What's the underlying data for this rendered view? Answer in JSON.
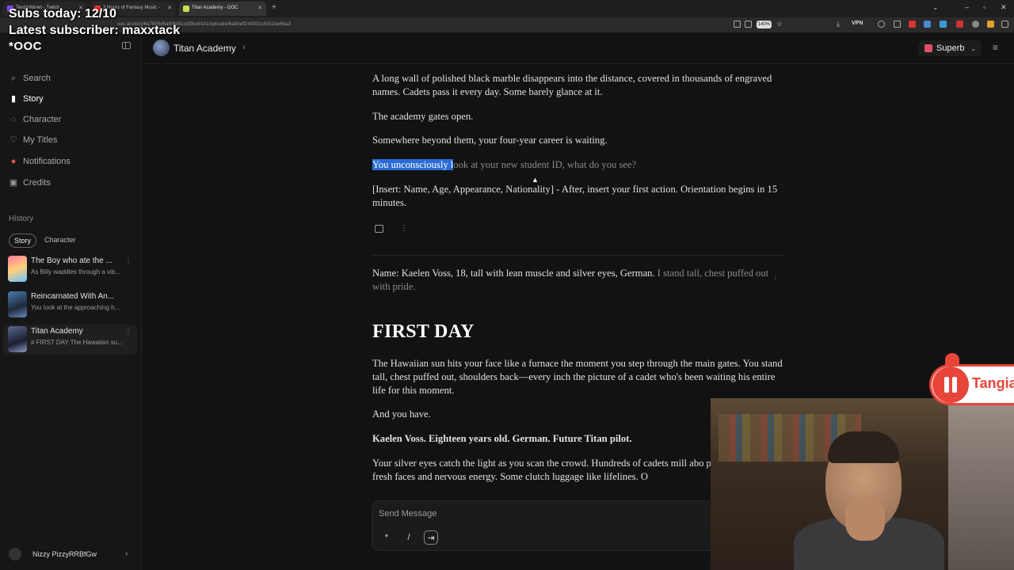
{
  "browser": {
    "tabs": [
      {
        "label": "TenzinNimet - Twitch",
        "color": "#9146ff"
      },
      {
        "label": "3 Hours of Fantasy Music -",
        "color": "#ff3030"
      },
      {
        "label": "Titan Academy - OOC",
        "color": "#c8e050"
      }
    ],
    "url": "ooc.ai/story/6a7b05d5af09e51cd3fce9141/episode/6a90eff240031c5011be65a3",
    "zoom": "140%",
    "vpn": "VPN"
  },
  "overlay": {
    "subs": "Subs today: 12/10",
    "latest": "Latest subscriber: maxxtack"
  },
  "sidebar": {
    "logo": "*OOC",
    "nav": [
      {
        "label": "Search",
        "icon": "search-icon"
      },
      {
        "label": "Story",
        "icon": "book-icon"
      },
      {
        "label": "Character",
        "icon": "chat-icon"
      },
      {
        "label": "My Titles",
        "icon": "heart-icon"
      },
      {
        "label": "Notifications",
        "icon": "bell-icon"
      },
      {
        "label": "Credits",
        "icon": "credits-icon"
      }
    ],
    "history_heading": "History",
    "filters": [
      "Story",
      "Character"
    ],
    "history": [
      {
        "title": "The Boy who ate the ...",
        "snippet": "As Billy waddles through a vib..."
      },
      {
        "title": "Reincarnated With An...",
        "snippet": "You look at the approaching h..."
      },
      {
        "title": "Titan Academy",
        "snippet": "# FIRST DAY The Hawaiian su..."
      }
    ],
    "user": "Nizzy PizzyRRBfGw"
  },
  "header": {
    "title": "Titan Academy",
    "model": "Superb"
  },
  "story": {
    "p1": "A long wall of polished black marble disappears into the distance, covered in thousands of engraved names. Cadets pass it every day. Some barely glance at it.",
    "p2": "The academy gates open.",
    "p3": "Somewhere beyond them, your four-year career is waiting.",
    "p4_highlight": "You unconsciously l",
    "p4_rest": "ook at your new student ID, what do you see?",
    "p5": "[Insert: Name, Age, Appearance, Nationality] - After, insert your first action. Orientation begins in 15 minutes.",
    "user_msg_main": "Name: Kaelen Voss, 18, tall with lean muscle and silver eyes, German.",
    "user_msg_action": "I stand tall, chest puffed out with pride.",
    "heading": "FIRST DAY",
    "r1": "The Hawaiian sun hits your face like a furnace the moment you step through the main gates. You stand tall, chest puffed out, shoulders back—every inch the picture of a cadet who's been waiting his entire life for this moment.",
    "r2": "And you have.",
    "r3": "Kaelen Voss. Eighteen years old. German. Future Titan pilot.",
    "r4": "Your silver eyes catch the light as you scan the crowd. Hundreds of cadets mill abo plaza, a sea of fresh faces and nervous energy. Some clutch luggage like lifelines. O"
  },
  "composer": {
    "placeholder": "Send Message",
    "buttons": [
      "*",
      "/",
      "⇥"
    ]
  },
  "tangia": {
    "label": "Tangia"
  }
}
